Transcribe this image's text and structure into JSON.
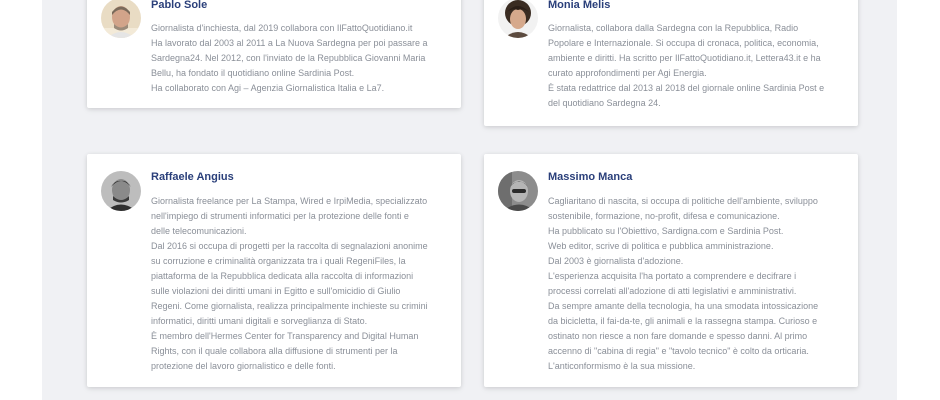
{
  "authors": [
    {
      "name": "Pablo Sole",
      "avatar": "portrait-pablo-sole",
      "bio_lines": [
        "Giornalista d'inchiesta, dal 2019 collabora con IlFattoQuotidiano.it",
        "Ha lavorato dal 2003 al 2011 a La Nuova Sardegna per poi passare a",
        "Sardegna24. Nel 2012, con l'inviato de la Repubblica Giovanni Maria",
        "Bellu, ha fondato il quotidiano online Sardinia Post.",
        "Ha collaborato con Agi – Agenzia Giornalistica Italia e La7."
      ]
    },
    {
      "name": "Monia Melis",
      "avatar": "portrait-monia-melis",
      "bio_lines": [
        "Giornalista, collabora dalla Sardegna con la Repubblica, Radio",
        "Popolare e Internazionale. Si occupa di cronaca, politica, economia,",
        "ambiente e diritti. Ha scritto per IlFattoQuotidiano.it, Lettera43.it e ha",
        "curato approfondimenti per Agi Energia.",
        "È stata redattrice dal 2013 al 2018 del giornale online Sardinia Post e",
        "del quotidiano Sardegna 24."
      ]
    },
    {
      "name": "Raffaele Angius",
      "avatar": "portrait-raffaele-angius",
      "bio_lines": [
        "Giornalista freelance per La Stampa, Wired e IrpiMedia, specializzato",
        "nell'impiego di strumenti informatici per la protezione delle fonti e",
        "delle telecomunicazioni.",
        "Dal 2016 si occupa di progetti per la raccolta di segnalazioni anonime",
        "su corruzione e criminalità organizzata tra i quali RegeniFiles, la",
        "piattaforma de la Repubblica dedicata alla raccolta di informazioni",
        "sulle violazioni dei diritti umani in Egitto e sull'omicidio di Giulio",
        "Regeni. Come giornalista, realizza principalmente inchieste su crimini",
        "informatici, diritti umani digitali e sorveglianza di Stato.",
        "È membro dell'Hermes Center for Transparency and Digital Human",
        "Rights, con il quale collabora alla diffusione di strumenti per la",
        "protezione del lavoro giornalistico e delle fonti."
      ]
    },
    {
      "name": "Massimo Manca",
      "avatar": "portrait-massimo-manca",
      "bio_lines": [
        "Cagliaritano di nascita, si occupa di politiche dell'ambiente, sviluppo",
        "sostenibile, formazione, no-profit, difesa e comunicazione.",
        "Ha pubblicato su l'Obiettivo, Sardigna.com e Sardinia Post.",
        "Web editor, scrive di politica e pubblica amministrazione.",
        "Dal 2003 è giornalista d'adozione.",
        "L'esperienza acquisita l'ha portato a comprendere e decifrare i",
        "processi correlati all'adozione di atti legislativi e amministrativi.",
        "Da sempre amante della tecnologia, ha una smodata intossicazione",
        "da bicicletta, il fai-da-te, gli animali e la rassegna stampa. Curioso e",
        "ostinato non riesce a non fare domande e spesso danni. Al primo",
        "accenno di \"cabina di regia\" e \"tavolo tecnico\" è colto da orticaria.",
        "L'anticonformismo è la sua missione."
      ]
    }
  ]
}
